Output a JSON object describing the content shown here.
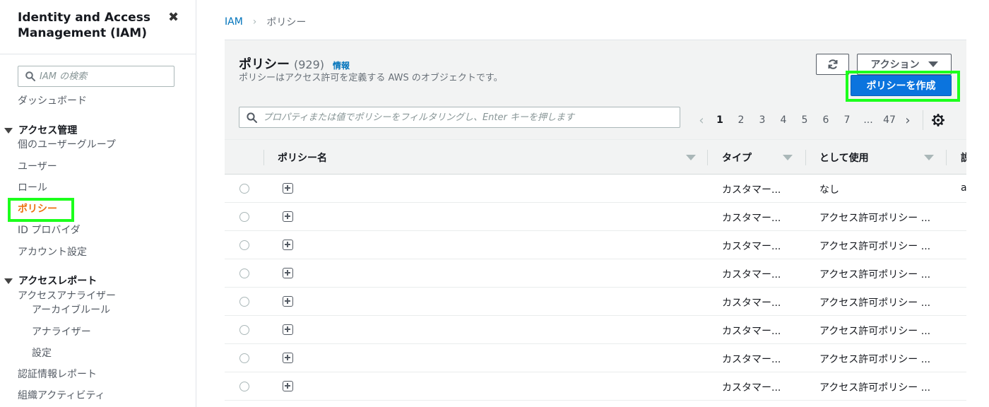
{
  "sidebar": {
    "title": "Identity and Access Management (IAM)",
    "search_placeholder": "IAM の検索",
    "dashboard": "ダッシュボード",
    "access_mgmt": {
      "label": "アクセス管理",
      "items": [
        "個のユーザーグループ",
        "ユーザー",
        "ロール",
        "ポリシー",
        "ID プロバイダ",
        "アカウント設定"
      ]
    },
    "access_reports": {
      "label": "アクセスレポート",
      "analyzer": "アクセスアナライザー",
      "sub_items": [
        "アーカイブルール",
        "アナライザー",
        "設定"
      ],
      "items": [
        "認証情報レポート",
        "組織アクティビティ"
      ]
    }
  },
  "breadcrumb": {
    "root": "IAM",
    "current": "ポリシー"
  },
  "header": {
    "title": "ポリシー",
    "count": "(929)",
    "info": "情報",
    "description": "ポリシーはアクセス許可を定義する AWS のオブジェクトです。",
    "actions_label": "アクション",
    "create_label": "ポリシーを作成"
  },
  "filter": {
    "placeholder": "プロパティまたは値でポリシーをフィルタリングし、Enter キーを押します"
  },
  "pagination": {
    "current": "1",
    "pages": [
      "1",
      "2",
      "3",
      "4",
      "5",
      "6",
      "7"
    ],
    "ellipsis": "...",
    "last": "47"
  },
  "table": {
    "columns": [
      "ポリシー名",
      "タイプ",
      "として使用",
      "説"
    ],
    "rows": [
      {
        "type": "カスタマー...",
        "usage": "なし",
        "desc": "a"
      },
      {
        "type": "カスタマー...",
        "usage": "アクセス許可ポリシー ...",
        "desc": ""
      },
      {
        "type": "カスタマー...",
        "usage": "アクセス許可ポリシー ...",
        "desc": ""
      },
      {
        "type": "カスタマー...",
        "usage": "アクセス許可ポリシー ...",
        "desc": ""
      },
      {
        "type": "カスタマー...",
        "usage": "アクセス許可ポリシー ...",
        "desc": ""
      },
      {
        "type": "カスタマー...",
        "usage": "アクセス許可ポリシー ...",
        "desc": ""
      },
      {
        "type": "カスタマー...",
        "usage": "アクセス許可ポリシー ...",
        "desc": ""
      },
      {
        "type": "カスタマー...",
        "usage": "アクセス許可ポリシー ...",
        "desc": ""
      }
    ]
  },
  "colors": {
    "link": "#0073bb",
    "active": "#ec7211",
    "primary": "#0b74de",
    "highlight": "#1cff1c"
  }
}
